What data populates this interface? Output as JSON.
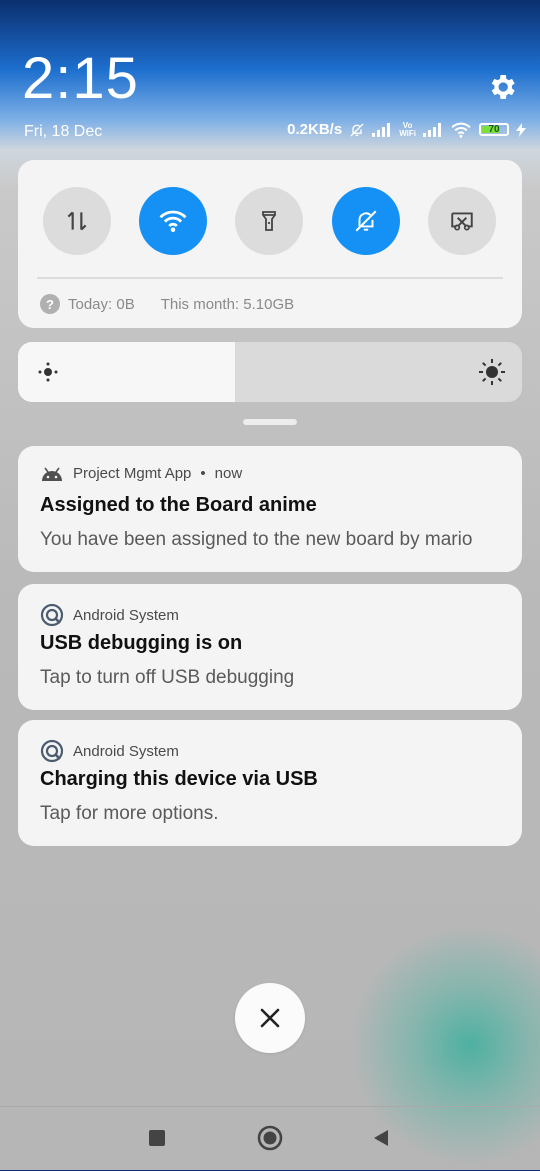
{
  "header": {
    "time": "2:15",
    "date": "Fri, 18 Dec",
    "network_speed": "0.2KB/s",
    "vowifi_label_top": "Vo",
    "vowifi_label_bottom": "WiFi",
    "battery_percent": "70"
  },
  "quick_settings": {
    "tiles": [
      {
        "name": "mobile-data",
        "icon": "mobile-data-arrows-icon",
        "active": false
      },
      {
        "name": "wifi",
        "icon": "wifi-icon",
        "active": true
      },
      {
        "name": "flashlight",
        "icon": "flashlight-icon",
        "active": false
      },
      {
        "name": "silent",
        "icon": "bell-off-icon",
        "active": true
      },
      {
        "name": "screenshot",
        "icon": "scissors-screenshot-icon",
        "active": false
      }
    ],
    "data_usage": {
      "help_glyph": "?",
      "today": "Today: 0B",
      "month": "This month: 5.10GB"
    }
  },
  "brightness": {
    "level_percent": 43
  },
  "notifications": [
    {
      "app": "Project Mgmt App",
      "separator": "•",
      "time": "now",
      "title": "Assigned to the Board anime",
      "text": "You have been assigned to the new board by mario",
      "icon": "android-robot-icon"
    },
    {
      "app": "Android System",
      "title": "USB debugging is on",
      "text": "Tap to turn off USB debugging",
      "icon": "android-system-icon"
    },
    {
      "app": "Android System",
      "title": "Charging this device via USB",
      "text": "Tap for more options.",
      "icon": "android-system-icon"
    }
  ],
  "colors": {
    "accent": "#1591f6",
    "tile_inactive": "#dcdcdc",
    "card_bg": "#f4f4f4"
  }
}
